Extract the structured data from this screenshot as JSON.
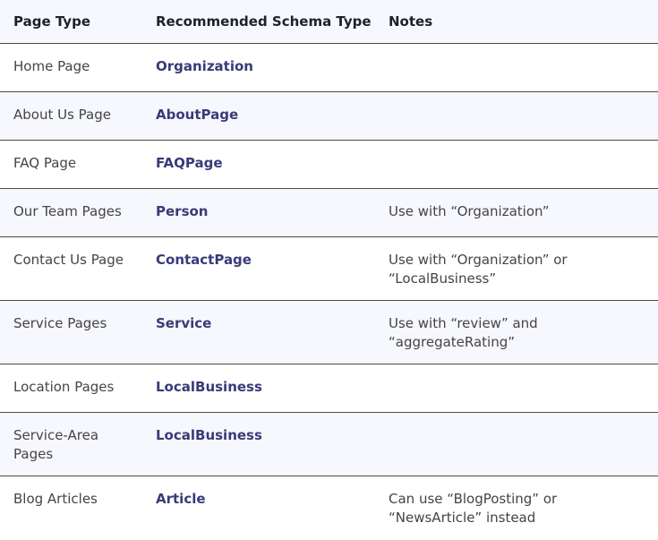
{
  "table": {
    "headers": [
      "Page Type",
      "Recommended Schema Type",
      "Notes"
    ],
    "rows": [
      {
        "page_type": "Home Page",
        "schema_type": "Organization",
        "notes": ""
      },
      {
        "page_type": "About Us Page",
        "schema_type": "AboutPage",
        "notes": ""
      },
      {
        "page_type": "FAQ Page",
        "schema_type": "FAQPage",
        "notes": ""
      },
      {
        "page_type": "Our Team Pages",
        "schema_type": "Person",
        "notes": "Use with “Organization”"
      },
      {
        "page_type": "Contact Us Page",
        "schema_type": "ContactPage",
        "notes": "Use with “Organization” or “LocalBusiness”"
      },
      {
        "page_type": "Service Pages",
        "schema_type": "Service",
        "notes": "Use with “review” and “aggregateRating”"
      },
      {
        "page_type": "Location Pages",
        "schema_type": "LocalBusiness",
        "notes": ""
      },
      {
        "page_type": "Service-Area Pages",
        "schema_type": "LocalBusiness",
        "notes": ""
      },
      {
        "page_type": "Blog Articles",
        "schema_type": "Article",
        "notes": "Can use “BlogPosting” or “NewsArticle” instead"
      }
    ]
  },
  "colors": {
    "header_background": "#f7f8fd",
    "alt_row_background": "#f7f8fd",
    "schema_link_text": "#3a3a78",
    "divider": "#4a4a4a"
  }
}
